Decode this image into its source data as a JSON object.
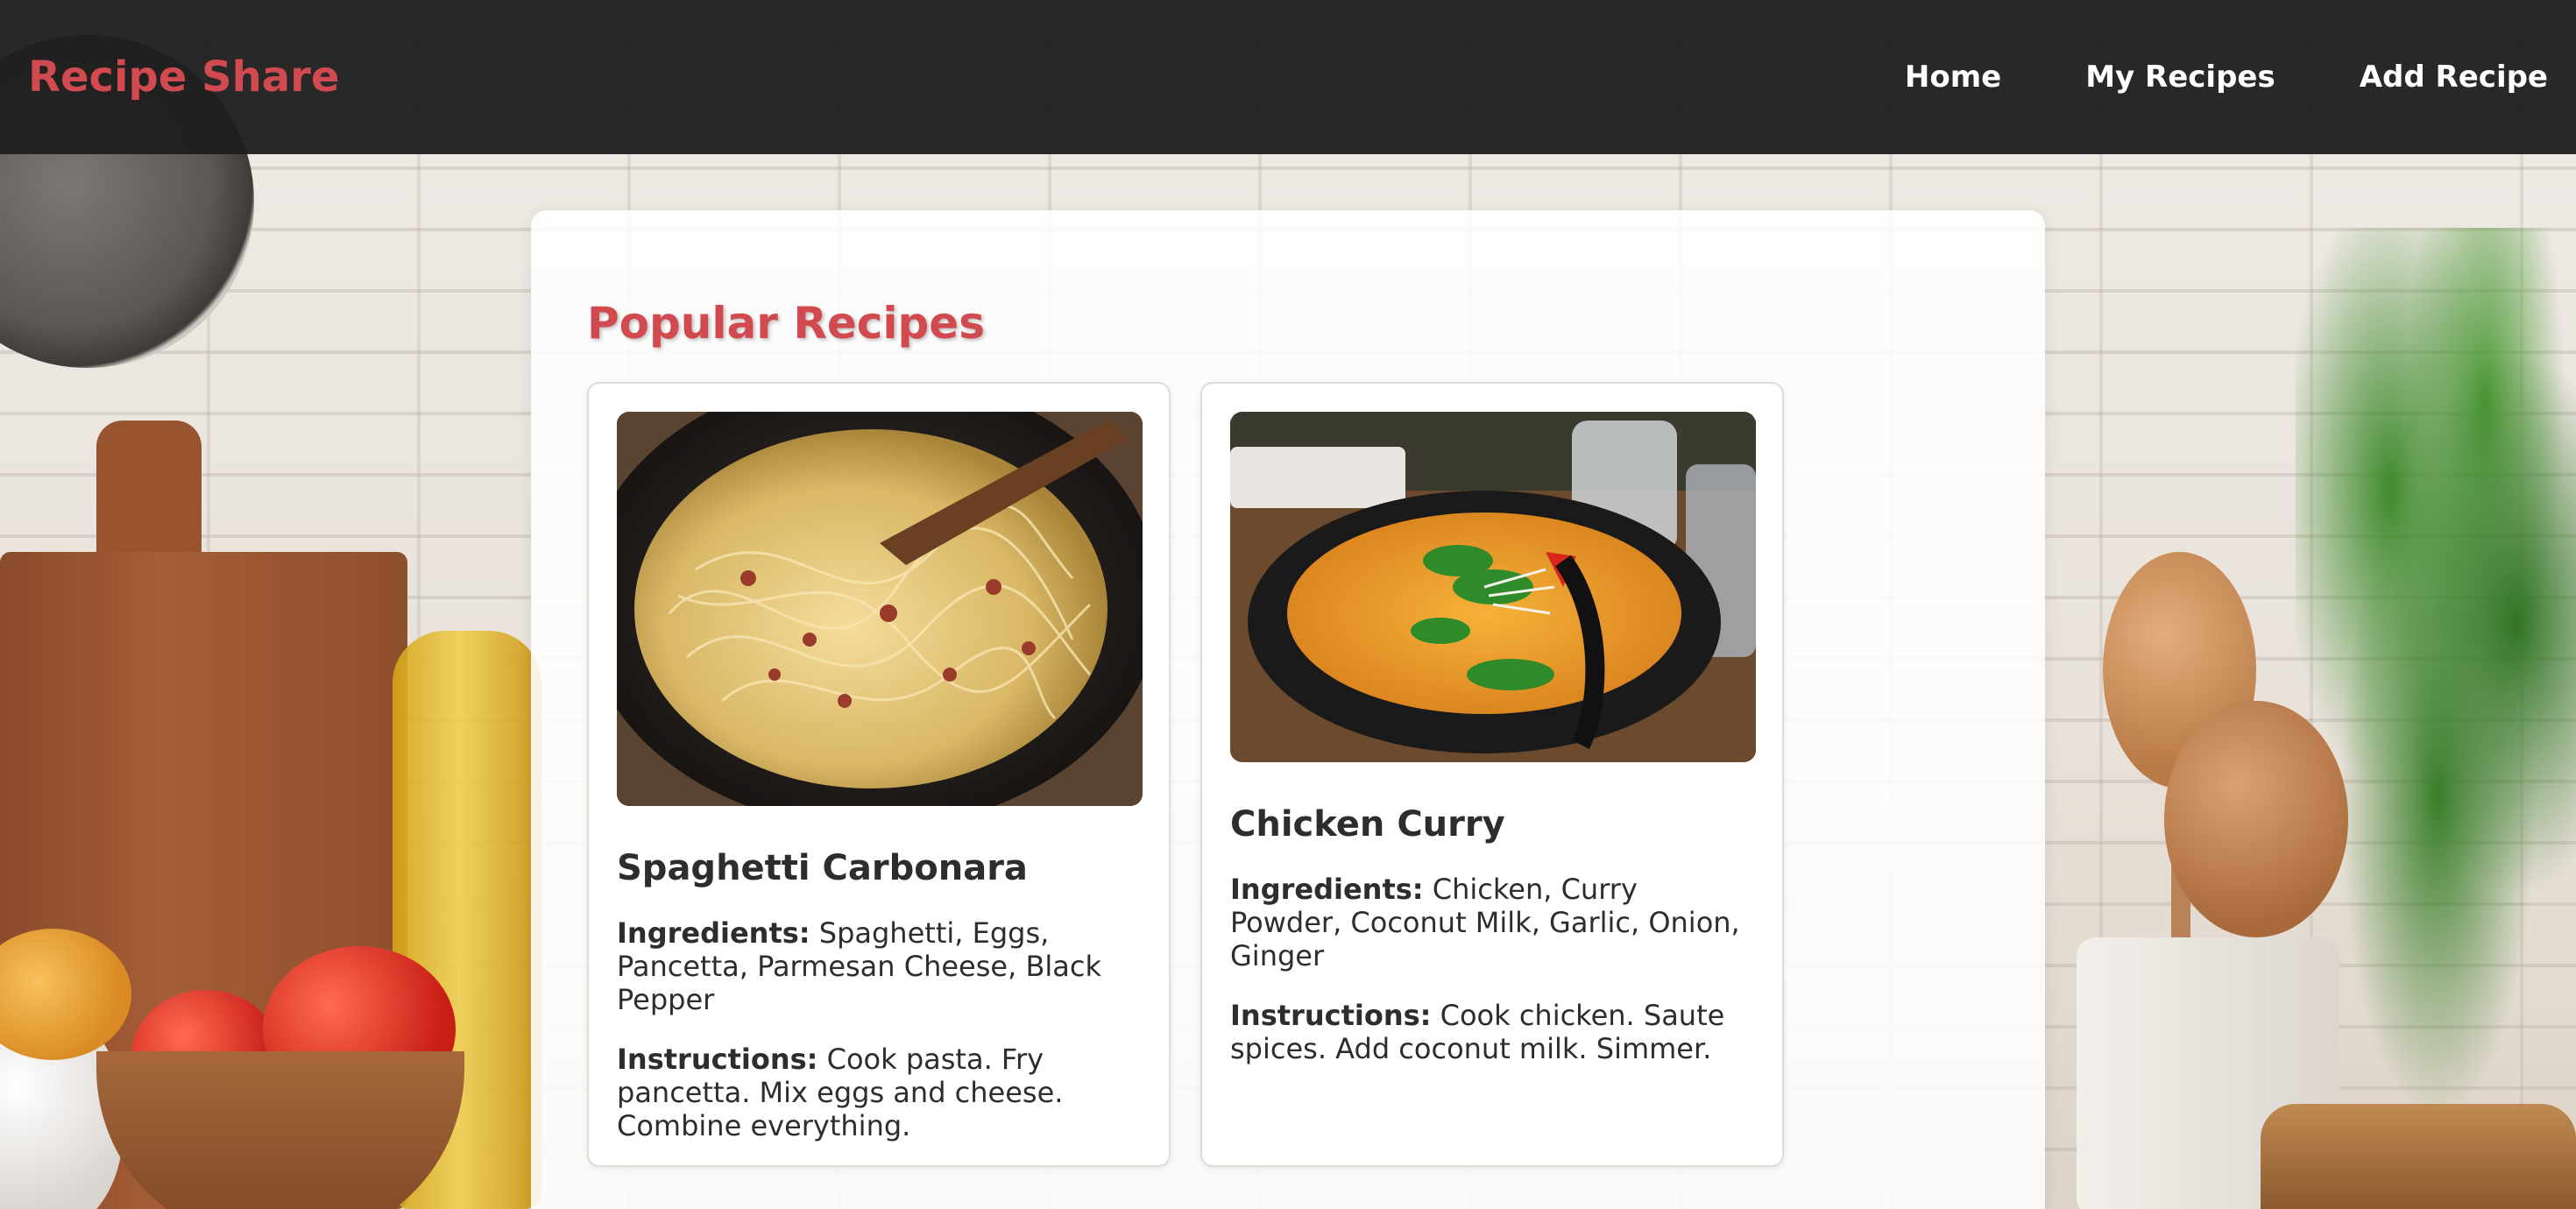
{
  "header": {
    "brand": "Recipe Share",
    "nav": [
      "Home",
      "My Recipes",
      "Add Recipe"
    ]
  },
  "main": {
    "section_title": "Popular Recipes",
    "recipes": [
      {
        "title": "Spaghetti Carbonara",
        "ingredients_label": "Ingredients:",
        "ingredients": "Spaghetti, Eggs, Pancetta, Parmesan Cheese, Black Pepper",
        "instructions_label": "Instructions:",
        "instructions": "Cook pasta. Fry pancetta. Mix eggs and cheese. Combine everything."
      },
      {
        "title": "Chicken Curry",
        "ingredients_label": "Ingredients:",
        "ingredients": "Chicken, Curry Powder, Coconut Milk, Garlic, Onion, Ginger",
        "instructions_label": "Instructions:",
        "instructions": "Cook chicken. Saute spices. Add coconut milk. Simmer."
      }
    ]
  },
  "colors": {
    "brand": "#d04a4f",
    "header_bg": "#1e1e1e",
    "text": "#2d2d2d"
  }
}
